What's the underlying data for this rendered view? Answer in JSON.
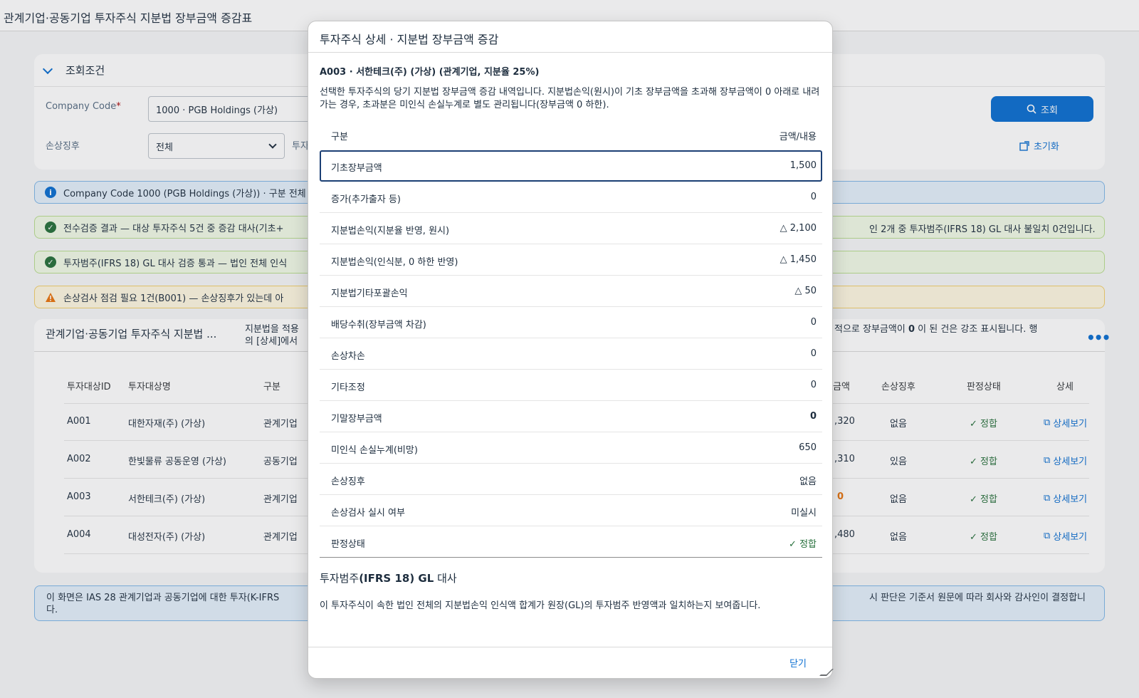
{
  "app": {
    "title": "관계기업·공동기업 투자주식 지분법 장부금액 증감표"
  },
  "filter": {
    "section_title": "조회조건",
    "company_code_label": "Company Code",
    "company_code_value": "1000 · PGB Holdings (가상)",
    "impairment_label": "손상징후",
    "impairment_value": "전체",
    "third_label_partial": "투자",
    "search_button": "조회",
    "reset_button": "초기화"
  },
  "messages": {
    "info": "Company Code 1000 (PGB Holdings (가상)) · 구분 전체",
    "check1_left": "전수검증 결과 — 대상 투자주식 5건 중 증감 대사(기초+",
    "check1_right": "인 2개 중 투자범주(IFRS 18) GL 대사 불일치 0건입니다.",
    "check2": "투자범주(IFRS 18) GL 대사 검증 통과 — 법인 전체 인식",
    "warning": "손상검사 점검 필요 1건(B001) — 손상징후가 있는데 아"
  },
  "table": {
    "title": "관계기업·공동기업 투자주식 지분법 ...",
    "desc_left_1": "지분법을 적용",
    "desc_left_2": "의 [상세]에서",
    "desc_right_a": "적으로 장부금액이 ",
    "desc_right_b": "0",
    "desc_right_c": " 이 된 건은 강조 표시됩니다. 행",
    "more": "•••",
    "columns": {
      "id": "투자대상ID",
      "name": "투자대상명",
      "type": "구분",
      "amount": "금액",
      "impairment": "손상징후",
      "status": "판정상태",
      "detail": "상세"
    },
    "rows": [
      {
        "id": "A001",
        "name": "대한자재(주) (가상)",
        "type": "관계기업",
        "amount": ",320",
        "impairment": "없음",
        "status": "정합",
        "detail": "상세보기"
      },
      {
        "id": "A002",
        "name": "한빛물류 공동운영 (가상)",
        "type": "공동기업",
        "amount": ",310",
        "impairment": "있음",
        "status": "정합",
        "detail": "상세보기"
      },
      {
        "id": "A003",
        "name": "서한테크(주) (가상)",
        "type": "관계기업",
        "amount": "0",
        "impairment": "없음",
        "status": "정합",
        "detail": "상세보기"
      },
      {
        "id": "A004",
        "name": "대성전자(주) (가상)",
        "type": "관계기업",
        "amount": ",480",
        "impairment": "없음",
        "status": "정합",
        "detail": "상세보기"
      }
    ]
  },
  "footnote": {
    "left_1": "이 화면은 IAS 28 관계기업과 공동기업에 대한 투자(K-IFRS",
    "left_2": "다.",
    "right": "시 판단은 기준서 원문에 따라 회사와 감사인이 결정합니"
  },
  "dialog": {
    "title": "투자주식 상세 · 지분법 장부금액 증감",
    "subtitle": "A003 · 서한테크(주) (가상) (관계기업, 지분율 25%)",
    "description": "선택한 투자주식의 당기 지분법 장부금액 증감 내역입니다. 지분법손익(원시)이 기초 장부금액을 초과해 장부금액이 0 아래로 내려가는 경우, 초과분은 미인식 손실누계로 별도 관리됩니다(장부금액 0 하한).",
    "col_label": "구분",
    "col_value": "금액/내용",
    "rows": [
      {
        "label": "기초장부금액",
        "value": "1,500"
      },
      {
        "label": "증가(추가출자 등)",
        "value": "0"
      },
      {
        "label": "지분법손익(지분율 반영, 원시)",
        "value": "△ 2,100"
      },
      {
        "label": "지분법손익(인식분, 0 하한 반영)",
        "value": "△ 1,450"
      },
      {
        "label": "지분법기타포괄손익",
        "value": "△ 50"
      },
      {
        "label": "배당수취(장부금액 차감)",
        "value": "0"
      },
      {
        "label": "손상차손",
        "value": "0"
      },
      {
        "label": "기타조정",
        "value": "0"
      },
      {
        "label": "기말장부금액",
        "value": "0"
      },
      {
        "label": "미인식 손실누계(비망)",
        "value": "650"
      },
      {
        "label": "손상징후",
        "value": "없음"
      },
      {
        "label": "손상검사 실시 여부",
        "value": "미실시"
      },
      {
        "label": "판정상태",
        "value": "정합"
      }
    ],
    "gl_title_a": "투자범주",
    "gl_title_b": "(IFRS 18) GL",
    "gl_title_c": " 대사",
    "gl_desc": "이 투자주식이 속한 법인 전체의 지분법손익 인식액 합계가 원장(GL)의 투자범주 반영액과 일치하는지 보여줍니다.",
    "close": "닫기"
  },
  "colors": {
    "accent": "#0a6ed1",
    "positive": "#256f3a",
    "critical": "#e9730c",
    "selected_border": "#1b3f74"
  }
}
